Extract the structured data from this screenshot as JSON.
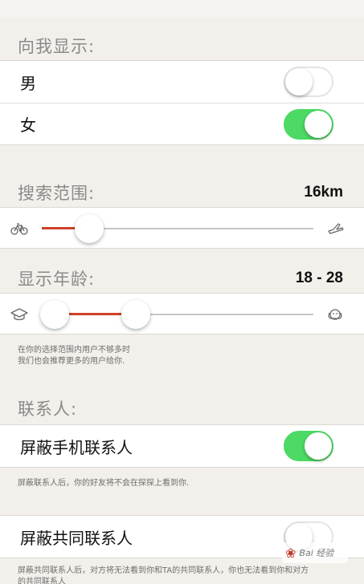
{
  "show_me": {
    "heading": "向我显示:",
    "rows": [
      {
        "label": "男",
        "on": false
      },
      {
        "label": "女",
        "on": true
      }
    ]
  },
  "search_range": {
    "heading": "搜索范围:",
    "value": "16km",
    "slider_fraction": 0.14,
    "left_icon": "bicycle-icon",
    "right_icon": "airplane-icon"
  },
  "age": {
    "heading": "显示年龄:",
    "value": "18 - 28",
    "low_fraction": 0.0,
    "high_fraction": 0.33,
    "left_icon": "graduation-cap-icon",
    "right_icon": "elderly-face-icon",
    "note_line1": "在你的选择范围内用户不够多时",
    "note_line2": "我们也会推荐更多的用户给你."
  },
  "contacts": {
    "heading": "联系人:",
    "block_phone_label": "屏蔽手机联系人",
    "block_phone_on": true,
    "block_phone_note": "屏蔽联系人后，你的好友将不会在探探上看到你.",
    "block_mutual_label": "屏蔽共同联系人",
    "block_mutual_on": false,
    "block_mutual_note_line1": "屏蔽共同联系人后，对方将无法看到你和TA的共同联系人，你也无法看到你和对方",
    "block_mutual_note_line2": "的共同联系人"
  },
  "colors": {
    "accent_green": "#4cd964",
    "slider_red": "#d0402a",
    "background": "#f3efeb"
  },
  "watermark": {
    "text": "Bai 经验"
  }
}
